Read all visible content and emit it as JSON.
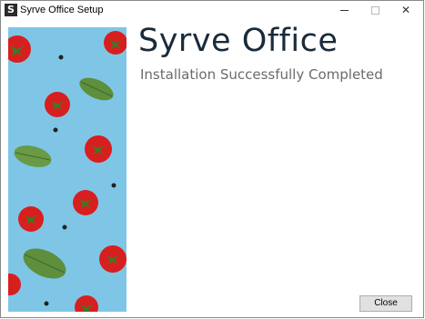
{
  "window": {
    "title": "Syrve Office Setup",
    "icon_letter": "S",
    "controls": {
      "minimize": "minimize-icon",
      "maximize": "maximize-icon",
      "close": "close-icon",
      "close_glyph": "✕"
    }
  },
  "main": {
    "heading": "Syrve Office",
    "subheading": "Installation Successfully Completed"
  },
  "footer": {
    "close_label": "Close"
  },
  "colors": {
    "banner_background": "#7fc6e6",
    "tomato": "#d81f1f",
    "basil": "#5d8f3c",
    "heading": "#1a2a3a",
    "subheading": "#6b6b6b"
  }
}
